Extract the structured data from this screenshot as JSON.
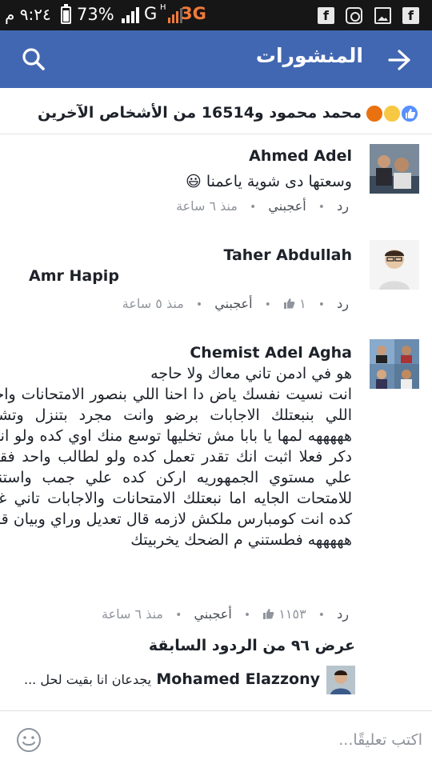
{
  "status_bar": {
    "time": "٩:٢٤ م",
    "battery": "73%",
    "network_g": "G",
    "network_h": "H",
    "network_3g": "3G"
  },
  "header": {
    "title": "المنشورات"
  },
  "reactions": {
    "summary": "محمد محمود و16514 من الأشخاص الآخرين"
  },
  "comments": [
    {
      "author": "Ahmed Adel",
      "text": "وسعتها دى شوية ياعمنا 😃",
      "time": "منذ ٦ ساعة",
      "like_label": "أعجبني",
      "reply_label": "رد",
      "like_count": ""
    },
    {
      "author": "Taher Abdullah",
      "text": "Amr Hapip",
      "time": "منذ ٥ ساعة",
      "like_label": "أعجبني",
      "reply_label": "رد",
      "like_count": "١"
    },
    {
      "author": "Chemist Adel Agha",
      "text": "هو في ادمن تاني معاك ولا حاجه\nانت نسيت نفسك ياض دا احنا اللي بنصور الامتحانات واحنا اللي بنبعتلك الاجابات برضو وانت مجرد بتنزل وتشير هههههه لمها يا بابا مش تخليها توسع منك اوي كده ولو انت دكر فعلا اثبت انك تقدر تعمل كده ولو لطالب واحد فقط علي مستوي الجمهوريه اركن كده علي جمب واستني للامتحات الجايه اما نبعتلك الامتحانات والاجابات تاني غير كده انت كومبارس ملكش لازمه قال تعديل وراي وبيان قال هههههه فطستني م الضحك يخربيتك",
      "time": "منذ ٦ ساعة",
      "like_label": "أعجبني",
      "reply_label": "رد",
      "like_count": "١١٥٣"
    }
  ],
  "view_previous": "عرض ٩٦ من الردود السابقة",
  "reply_preview": {
    "name": "Mohamed Elazzony",
    "snippet": "يجدعان انا بقيت لحل ..."
  },
  "composer": {
    "placeholder": "اكتب تعليقًا..."
  },
  "colors": {
    "header_bg": "#4267b2",
    "status_bg": "#161616"
  }
}
